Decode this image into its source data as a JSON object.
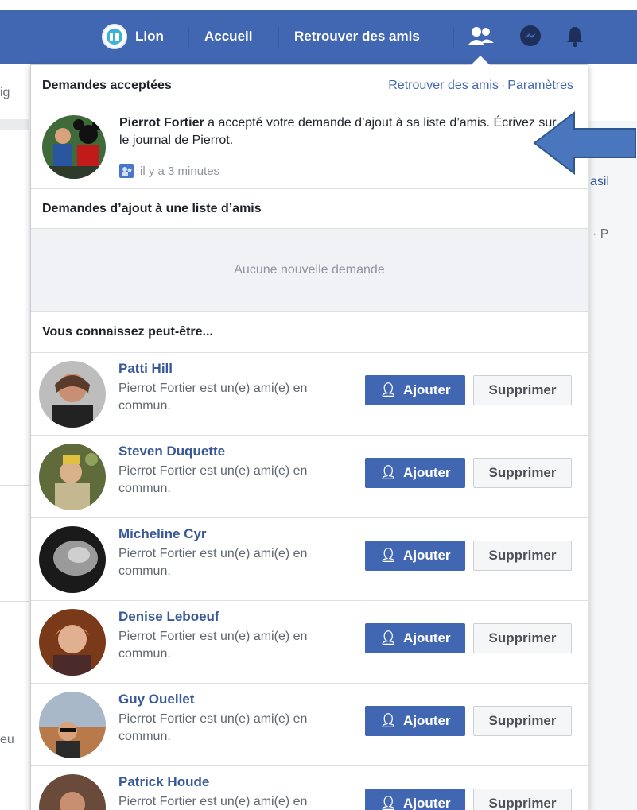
{
  "nav": {
    "profile_name": "Lion",
    "home": "Accueil",
    "find_friends": "Retrouver des amis"
  },
  "background": {
    "frag_left1": "ig",
    "frag_right1": "asil",
    "frag_right2": "· P",
    "frag_left2": "eu"
  },
  "panel": {
    "header_title": "Demandes acceptées",
    "link_find": "Retrouver des amis",
    "link_settings": "Paramètres",
    "accepted": {
      "name": "Pierrot Fortier",
      "message": " a accepté votre demande d’ajout à sa liste d’amis. Écrivez sur le journal de Pierrot.",
      "time": "il y a 3 minutes"
    },
    "requests_title": "Demandes d’ajout à une liste d’amis",
    "empty_text": "Aucune nouvelle demande",
    "pymk_title": "Vous connaissez peut-être...",
    "add_label": "Ajouter",
    "delete_label": "Supprimer",
    "people": [
      {
        "name": "Patti Hill",
        "mutual": "Pierrot Fortier est un(e) ami(e) en commun."
      },
      {
        "name": "Steven Duquette",
        "mutual": "Pierrot Fortier est un(e) ami(e) en commun."
      },
      {
        "name": "Micheline Cyr",
        "mutual": "Pierrot Fortier est un(e) ami(e) en commun."
      },
      {
        "name": "Denise Leboeuf",
        "mutual": "Pierrot Fortier est un(e) ami(e) en commun."
      },
      {
        "name": "Guy Ouellet",
        "mutual": "Pierrot Fortier est un(e) ami(e) en commun."
      },
      {
        "name": "Patrick Houde",
        "mutual": "Pierrot Fortier est un(e) ami(e) en"
      }
    ]
  },
  "colors": {
    "brand_blue": "#4267b2",
    "link_blue": "#385898",
    "arrow_blue": "#4a76bd"
  }
}
